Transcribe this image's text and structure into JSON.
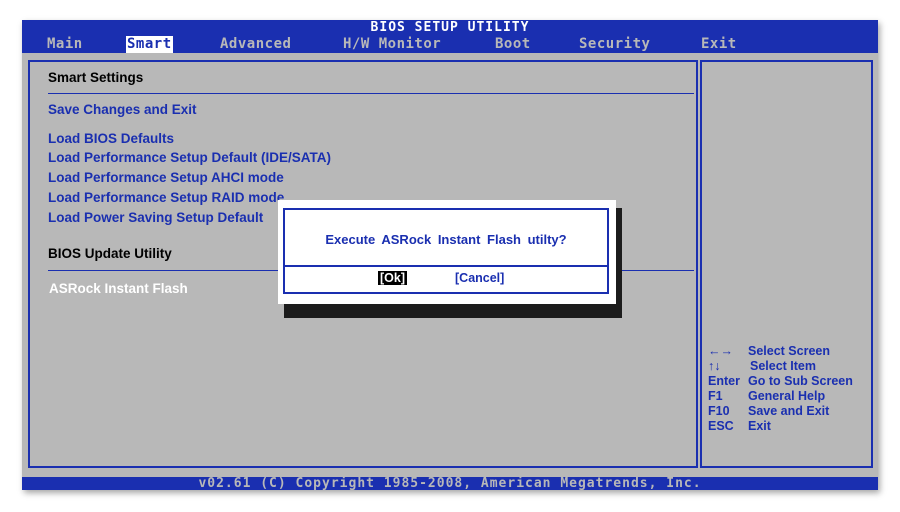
{
  "title": "BIOS SETUP UTILITY",
  "menu": [
    {
      "label": "Main"
    },
    {
      "label": "Smart",
      "active": true
    },
    {
      "label": "Advanced"
    },
    {
      "label": "H/W Monitor"
    },
    {
      "label": "Boot"
    },
    {
      "label": "Security"
    },
    {
      "label": "Exit"
    }
  ],
  "main": {
    "heading": "Smart Settings",
    "items": [
      "Save Changes and Exit",
      "Load BIOS Defaults",
      "Load Performance Setup Default (IDE/SATA)",
      "Load Performance Setup AHCI mode",
      "Load Performance Setup RAID mode",
      "Load Power Saving Setup Default"
    ],
    "update_heading": "BIOS Update Utility",
    "update_item": "ASRock Instant Flash"
  },
  "help": [
    {
      "key": "←→",
      "desc": "Select Screen"
    },
    {
      "key": "↑↓",
      "desc": "Select Item"
    },
    {
      "key": "Enter",
      "desc": "Go to Sub Screen"
    },
    {
      "key": "F1",
      "desc": "General Help"
    },
    {
      "key": "F10",
      "desc": "Save and Exit"
    },
    {
      "key": "ESC",
      "desc": "Exit"
    }
  ],
  "dialog": {
    "message": "Execute ASRock Instant Flash utilty?",
    "ok_label": "[Ok]",
    "cancel_label": "[Cancel]"
  },
  "footer": "v02.61 (C) Copyright 1985-2008, American Megatrends, Inc.",
  "colors": {
    "bios_blue": "#1a2fb0",
    "panel_gray": "#b8b8b8",
    "text_white": "#ffffff"
  }
}
